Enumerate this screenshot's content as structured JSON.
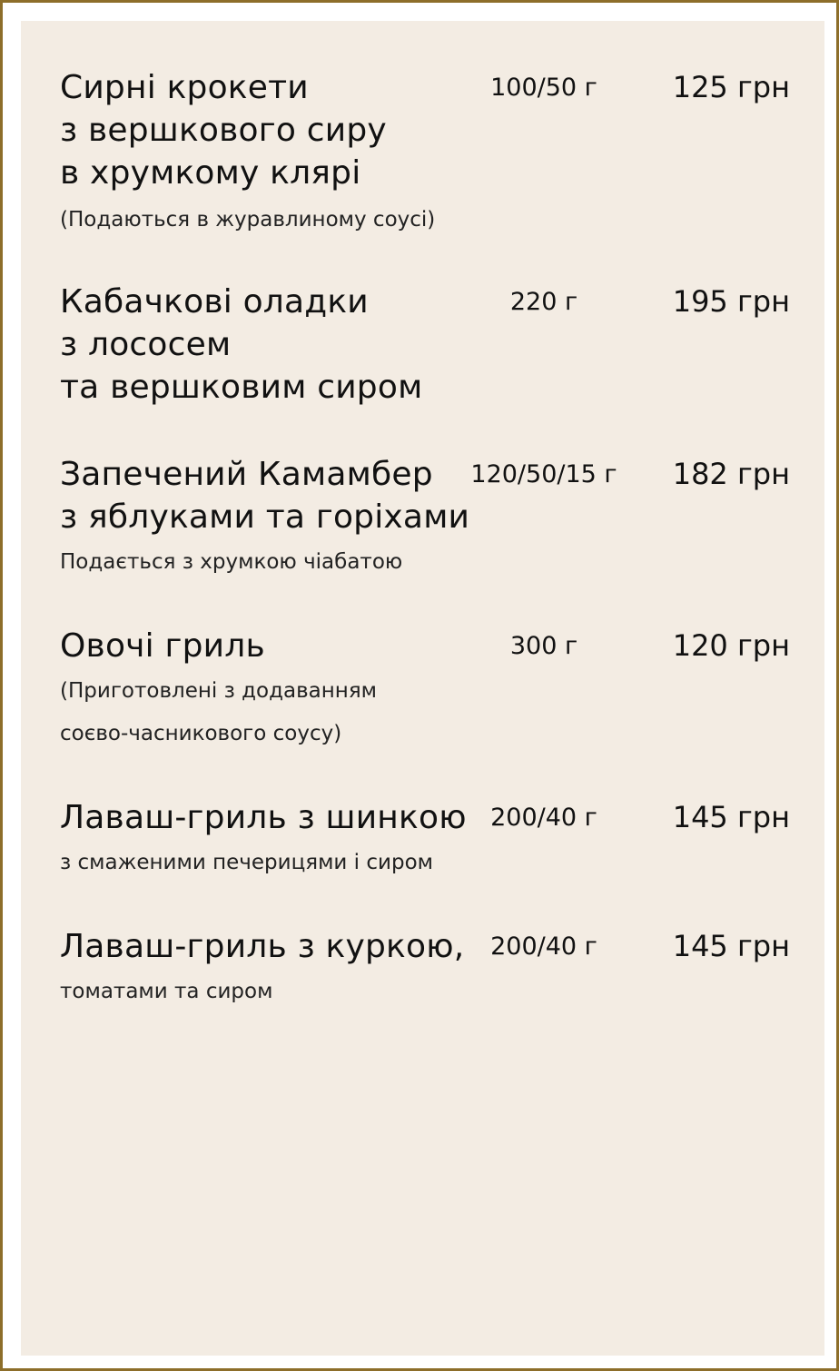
{
  "menu": {
    "items": [
      {
        "name_lines": [
          "Сирні крокети",
          "з вершкового сиру",
          "в хрумкому клярі"
        ],
        "desc_lines": [
          "(Подаються в журавлиному соусі)"
        ],
        "weight": "100/50 г",
        "price": "125 грн"
      },
      {
        "name_lines": [
          "Кабачкові оладки",
          "з лососем",
          "та вершковим сиром"
        ],
        "desc_lines": [],
        "weight": "220 г",
        "price": "195 грн"
      },
      {
        "name_lines": [
          "Запечений Камамбер",
          "з яблуками та горіхами"
        ],
        "desc_lines": [
          "Подається з хрумкою чіабатою"
        ],
        "weight": "120/50/15 г",
        "price": "182 грн"
      },
      {
        "name_lines": [
          "Овочі  гриль"
        ],
        "desc_lines": [
          "(Приготовлені з додаванням",
          "соєво-часникового соусу)"
        ],
        "weight": "300 г",
        "price": "120 грн"
      },
      {
        "name_lines": [
          "Лаваш-гриль з шинкою"
        ],
        "desc_lines": [
          "з смаженими печерицями і сиром"
        ],
        "weight": "200/40 г",
        "price": "145 грн"
      },
      {
        "name_lines": [
          "Лаваш-гриль з куркою,"
        ],
        "desc_lines": [
          "томатами та сиром"
        ],
        "weight": "200/40 г",
        "price": "145 грн"
      }
    ]
  },
  "colors": {
    "frame": "#8d6e2a",
    "panel": "#f3ece3",
    "text": "#111111"
  }
}
